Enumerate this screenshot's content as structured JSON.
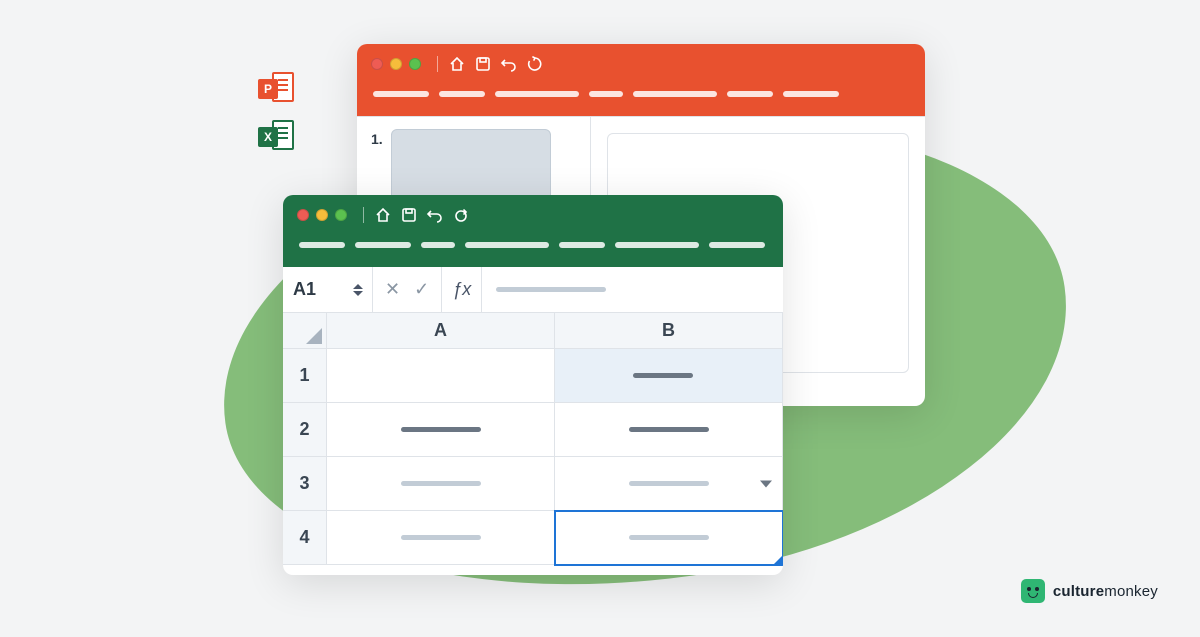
{
  "icons": {
    "powerpoint_badge": "P",
    "excel_badge": "X"
  },
  "ppt": {
    "toolbar_icons": [
      "home",
      "save",
      "undo",
      "redo"
    ],
    "thumbs": [
      {
        "index": "1."
      }
    ],
    "tabs": [
      "",
      "",
      "",
      "",
      "",
      "",
      ""
    ]
  },
  "excel": {
    "toolbar_icons": [
      "home",
      "save",
      "undo",
      "redo"
    ],
    "tabs": [
      "",
      "",
      "",
      "",
      "",
      "",
      ""
    ],
    "namebox": "A1",
    "fx_label": "ƒx",
    "columns": [
      "A",
      "B"
    ],
    "rows": [
      "1",
      "2",
      "3",
      "4"
    ]
  },
  "brand": {
    "bold": "culture",
    "light": "monkey"
  }
}
